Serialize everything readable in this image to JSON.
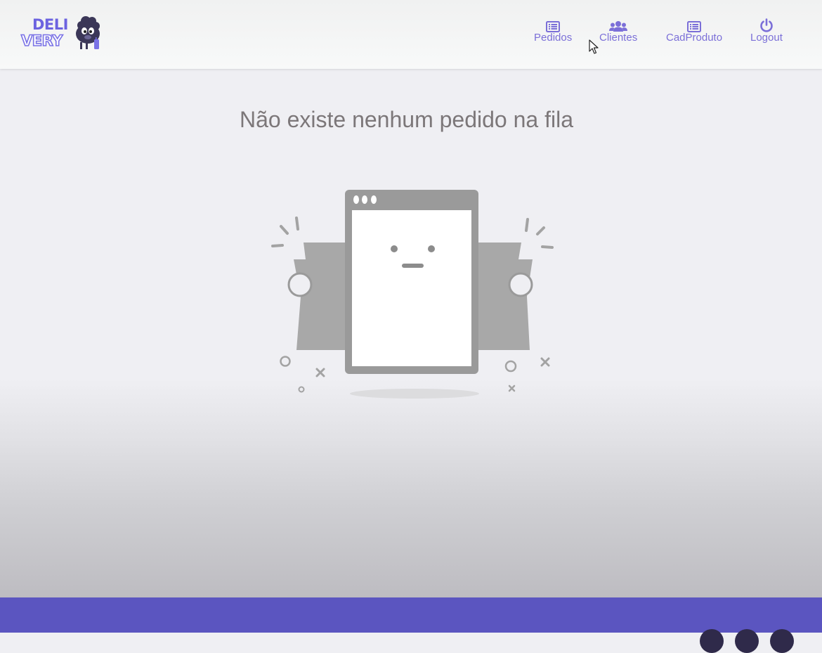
{
  "brand": {
    "line1": "DELI",
    "line2": "VERY"
  },
  "nav": {
    "items": [
      {
        "label": "Pedidos",
        "icon": "list-icon"
      },
      {
        "label": "Clientes",
        "icon": "users-icon"
      },
      {
        "label": "CadProduto",
        "icon": "list-icon"
      },
      {
        "label": "Logout",
        "icon": "power-icon"
      }
    ]
  },
  "main": {
    "empty_message": "Não existe nenhum pedido na fila",
    "illustration": "empty-window-illustration"
  },
  "colors": {
    "accent": "#7b6fd8",
    "footer": "#5b55c0",
    "background": "#efeff3"
  }
}
